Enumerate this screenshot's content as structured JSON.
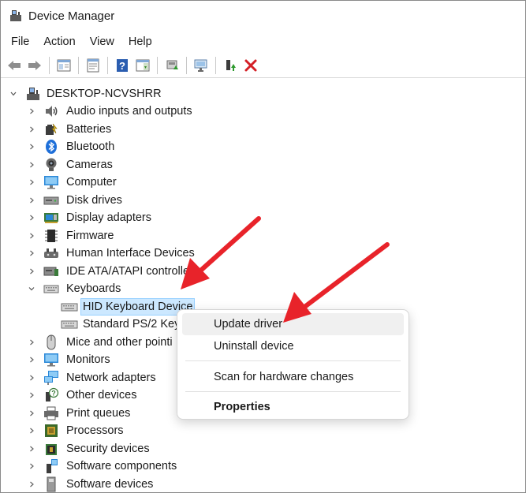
{
  "window": {
    "title": "Device Manager"
  },
  "menu": [
    "File",
    "Action",
    "View",
    "Help"
  ],
  "toolbar": {
    "buttons": [
      "back-icon",
      "forward-icon",
      "show-hide-console-tree-icon",
      "properties-icon",
      "help-icon",
      "action-pane-icon",
      "update-driver-icon",
      "scan-hardware-icon",
      "enable-device-icon",
      "uninstall-device-icon"
    ]
  },
  "tree": {
    "root": "DESKTOP-NCVSHRR",
    "items": [
      {
        "label": "Audio inputs and outputs",
        "icon": "speaker-icon"
      },
      {
        "label": "Batteries",
        "icon": "battery-icon"
      },
      {
        "label": "Bluetooth",
        "icon": "bluetooth-icon"
      },
      {
        "label": "Cameras",
        "icon": "camera-icon"
      },
      {
        "label": "Computer",
        "icon": "computer-icon"
      },
      {
        "label": "Disk drives",
        "icon": "disk-drive-icon"
      },
      {
        "label": "Display adapters",
        "icon": "display-adapter-icon"
      },
      {
        "label": "Firmware",
        "icon": "firmware-chip-icon"
      },
      {
        "label": "Human Interface Devices",
        "icon": "hid-icon"
      },
      {
        "label": "IDE ATA/ATAPI controllers",
        "icon": "ide-controller-icon"
      },
      {
        "label": "Keyboards",
        "icon": "keyboard-icon",
        "expanded": true,
        "children": [
          {
            "label": "HID Keyboard Device",
            "icon": "keyboard-icon",
            "selected": true
          },
          {
            "label": "Standard PS/2 Key",
            "icon": "keyboard-icon"
          }
        ]
      },
      {
        "label": "Mice and other pointi",
        "icon": "mouse-icon"
      },
      {
        "label": "Monitors",
        "icon": "monitor-icon"
      },
      {
        "label": "Network adapters",
        "icon": "network-adapter-icon"
      },
      {
        "label": "Other devices",
        "icon": "other-devices-icon"
      },
      {
        "label": "Print queues",
        "icon": "printer-icon"
      },
      {
        "label": "Processors",
        "icon": "processor-icon"
      },
      {
        "label": "Security devices",
        "icon": "security-device-icon"
      },
      {
        "label": "Software components",
        "icon": "software-component-icon"
      },
      {
        "label": "Software devices",
        "icon": "software-device-icon"
      }
    ]
  },
  "context_menu": {
    "items": [
      "Update driver",
      "Uninstall device",
      "Scan for hardware changes",
      "Properties"
    ],
    "hovered": "Update driver",
    "default": "Properties"
  },
  "colors": {
    "selection": "#cce8ff",
    "annotation_arrow": "#e8232a",
    "uninstall_x": "#d41f26"
  }
}
